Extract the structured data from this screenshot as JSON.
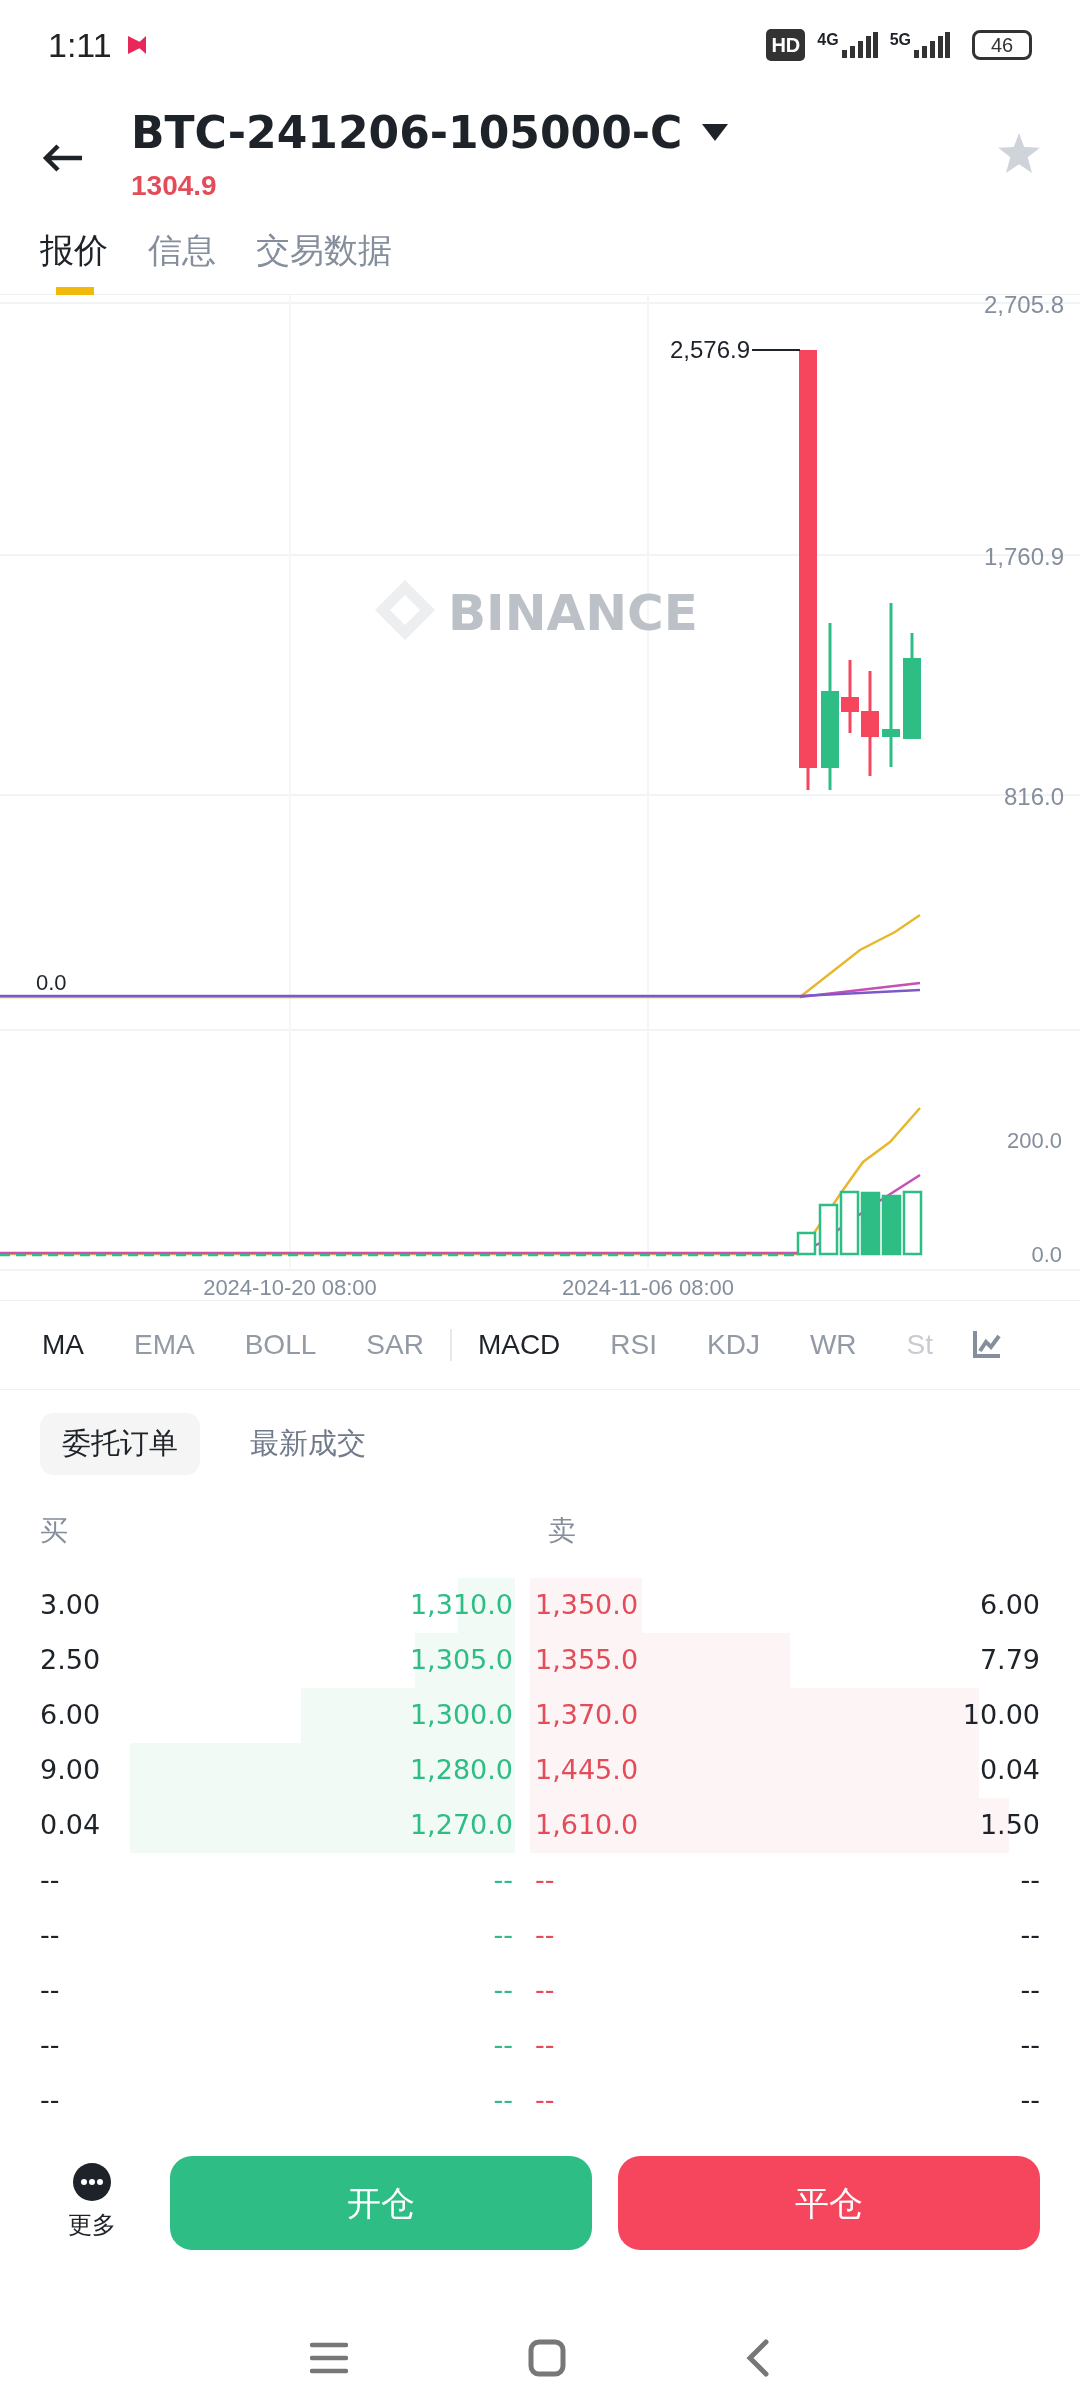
{
  "status_bar": {
    "time": "1:11",
    "hd": "HD",
    "network_1": "4G",
    "network_2": "5G",
    "battery": "46"
  },
  "header": {
    "title": "BTC-241206-105000-C",
    "price": "1304.9"
  },
  "tabs": [
    {
      "label": "报价",
      "selected": true
    },
    {
      "label": "信息",
      "selected": false
    },
    {
      "label": "交易数据",
      "selected": false
    }
  ],
  "chart": {
    "y_labels": [
      "2,705.8",
      "1,760.9",
      "816.0"
    ],
    "high_label": "2,576.9",
    "watermark": "BINANCE",
    "indicator_zero": "0.0",
    "macd_labels": [
      "200.0",
      "0.0"
    ],
    "x_labels": [
      "2024-10-20 08:00",
      "2024-11-06 08:00"
    ]
  },
  "main_indicators": [
    {
      "label": "MA",
      "selected": true
    },
    {
      "label": "EMA",
      "selected": false
    },
    {
      "label": "BOLL",
      "selected": false
    },
    {
      "label": "SAR",
      "selected": false
    }
  ],
  "sub_indicators": [
    {
      "label": "MACD",
      "selected": true
    },
    {
      "label": "RSI",
      "selected": false
    },
    {
      "label": "KDJ",
      "selected": false
    },
    {
      "label": "WR",
      "selected": false
    },
    {
      "label": "St",
      "selected": false
    }
  ],
  "order_tabs": [
    {
      "label": "委托订单",
      "selected": true
    },
    {
      "label": "最新成交",
      "selected": false
    }
  ],
  "order_book": {
    "bid_header": "买",
    "ask_header": "卖",
    "bids": [
      {
        "qty": "3.00",
        "price": "1,310.0",
        "level": 0.12
      },
      {
        "qty": "2.50",
        "price": "1,305.0",
        "level": 0.21
      },
      {
        "qty": "6.00",
        "price": "1,300.0",
        "level": 0.45
      },
      {
        "qty": "9.00",
        "price": "1,280.0",
        "level": 0.81
      },
      {
        "qty": "0.04",
        "price": "1,270.0",
        "level": 0.81
      },
      {
        "qty": "--",
        "price": "--"
      },
      {
        "qty": "--",
        "price": "--"
      },
      {
        "qty": "--",
        "price": "--"
      },
      {
        "qty": "--",
        "price": "--"
      },
      {
        "qty": "--",
        "price": "--"
      }
    ],
    "asks": [
      {
        "price": "1,350.0",
        "qty": "6.00",
        "level": 0.22
      },
      {
        "price": "1,355.0",
        "qty": "7.79",
        "level": 0.51
      },
      {
        "price": "1,370.0",
        "qty": "10.00",
        "level": 0.88
      },
      {
        "price": "1,445.0",
        "qty": "0.04",
        "level": 0.88
      },
      {
        "price": "1,610.0",
        "qty": "1.50",
        "level": 0.94
      },
      {
        "price": "--",
        "qty": "--"
      },
      {
        "price": "--",
        "qty": "--"
      },
      {
        "price": "--",
        "qty": "--"
      },
      {
        "price": "--",
        "qty": "--"
      },
      {
        "price": "--",
        "qty": "--"
      }
    ]
  },
  "bottom_bar": {
    "more_label": "更多",
    "buttons": [
      {
        "label": "开仓",
        "kind": "buy"
      },
      {
        "label": "平仓",
        "kind": "sell"
      }
    ]
  }
}
